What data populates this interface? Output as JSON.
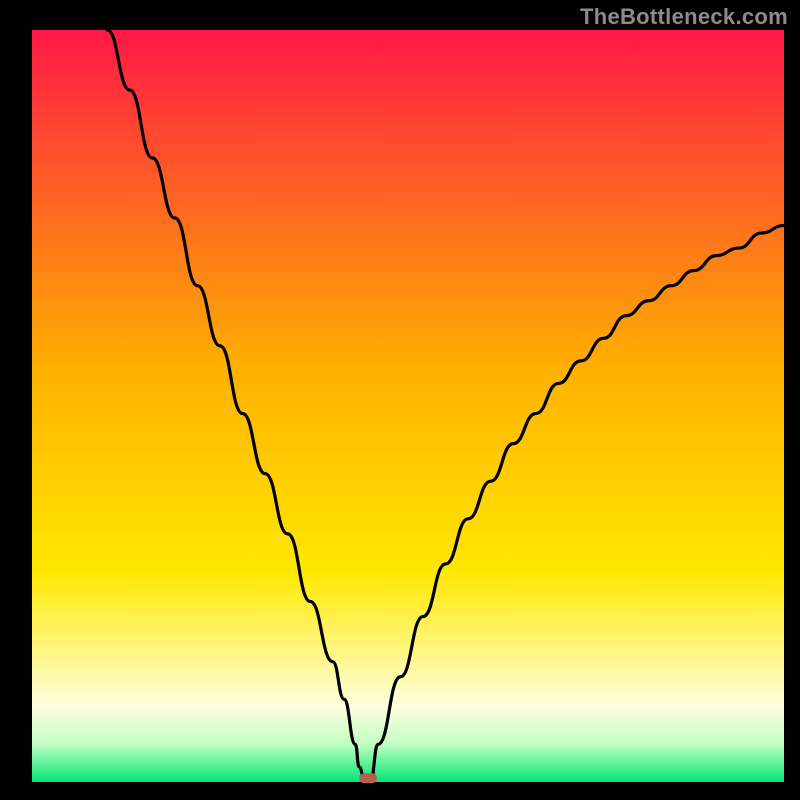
{
  "watermark": "TheBottleneck.com",
  "chart_data": {
    "type": "line",
    "title": "",
    "xlabel": "",
    "ylabel": "",
    "xlim": [
      0,
      100
    ],
    "ylim": [
      0,
      100
    ],
    "grid": false,
    "series": [
      {
        "name": "curve",
        "x": [
          10,
          13,
          16,
          19,
          22,
          25,
          28,
          31,
          34,
          37,
          40,
          41.5,
          43,
          43.5,
          44.3,
          45,
          46,
          49,
          52,
          55,
          58,
          61,
          64,
          67,
          70,
          73,
          76,
          79,
          82,
          85,
          88,
          91,
          94,
          97,
          100
        ],
        "values": [
          100,
          92,
          83,
          75,
          66,
          58,
          49,
          41,
          33,
          24,
          16,
          11,
          5,
          2,
          0,
          0,
          5,
          14,
          22,
          29,
          35,
          40,
          45,
          49,
          53,
          56,
          59,
          62,
          64,
          66,
          68,
          70,
          71,
          73,
          74
        ]
      }
    ],
    "marker": {
      "x": 44.7,
      "y": 0.5
    },
    "gradient_stops": [
      {
        "offset": 0.0,
        "color": "#ff1846"
      },
      {
        "offset": 0.45,
        "color": "#ffb000"
      },
      {
        "offset": 0.72,
        "color": "#ffe800"
      },
      {
        "offset": 0.85,
        "color": "#fff9a0"
      },
      {
        "offset": 0.9,
        "color": "#ffffe0"
      },
      {
        "offset": 0.95,
        "color": "#c0ffc0"
      },
      {
        "offset": 1.0,
        "color": "#00e676"
      }
    ],
    "border_color": "#000000",
    "curve_color": "#000000",
    "marker_color": "#b95e4b"
  }
}
